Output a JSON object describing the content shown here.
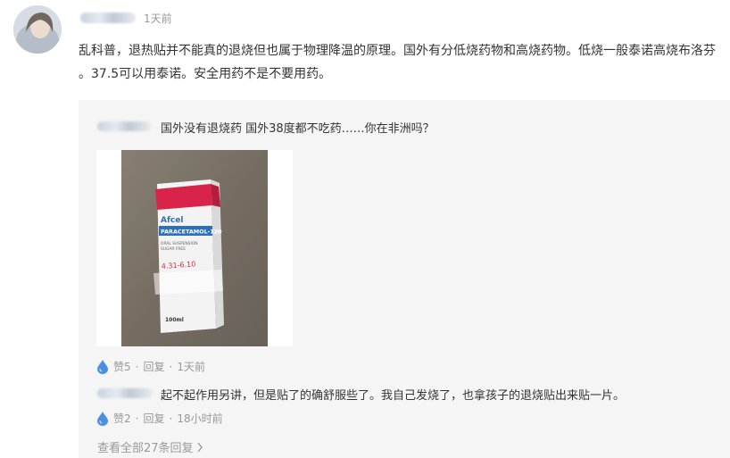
{
  "comment": {
    "time": "1天前",
    "text": "乱科普，退热贴并不能真的退烧但也属于物理降温的原理。国外有分低烧药物和高烧药物。低烧一般泰诺高烧布洛芬 。37.5可以用泰诺。安全用药不是不要用药。"
  },
  "replies": [
    {
      "text": "国外没有退烧药 国外38度都不吃药……你在非洲吗？",
      "photo": {
        "brand": "Afcel",
        "product": "PARACETAMOL-120",
        "lines": [
          "ORAL SUSPENSION",
          "SUGAR FREE"
        ],
        "handwritten": "4.31-6.10",
        "volume": "100ml"
      },
      "likes": "赞5",
      "reply_label": "回复",
      "separator": "·",
      "time": "1天前"
    },
    {
      "text": "起不起作用另讲，但是贴了的确舒服些了。我自己发烧了，也拿孩子的退烧贴出来贴一片。",
      "likes": "赞2",
      "reply_label": "回复",
      "separator": "·",
      "time": "18小时前"
    }
  ],
  "view_all": "查看全部27条回复",
  "colors": {
    "text": "#333333",
    "meta": "#999999",
    "panel": "#f5f5f5",
    "like_icon": "#4a90e2",
    "box_red": "#d8244a",
    "label_blue": "#2f6fb8"
  }
}
